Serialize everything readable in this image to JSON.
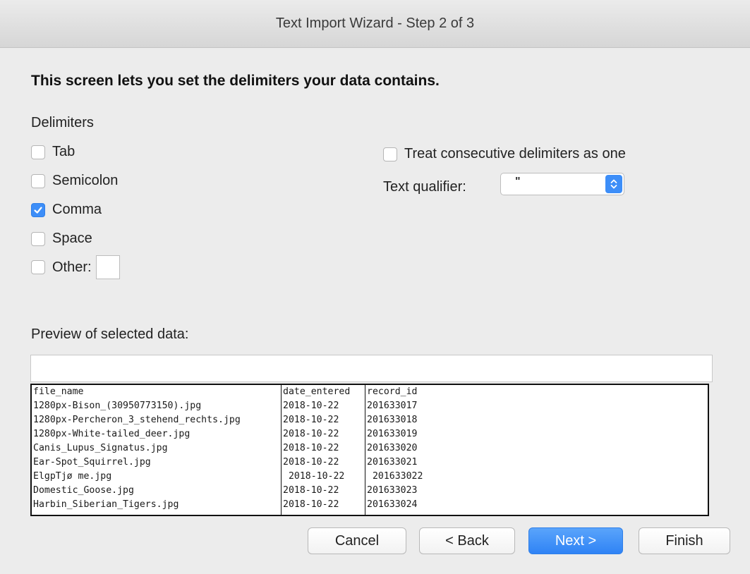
{
  "window": {
    "title": "Text Import Wizard - Step 2 of 3"
  },
  "heading": "This screen lets you set the delimiters your data contains.",
  "delimiters": {
    "label": "Delimiters",
    "tab": {
      "label": "Tab",
      "checked": false
    },
    "semicolon": {
      "label": "Semicolon",
      "checked": false
    },
    "comma": {
      "label": "Comma",
      "checked": true
    },
    "space": {
      "label": "Space",
      "checked": false
    },
    "other": {
      "label": "Other:",
      "checked": false,
      "value": ""
    }
  },
  "consecutive": {
    "label": "Treat consecutive delimiters as one",
    "checked": false
  },
  "qualifier": {
    "label": "Text qualifier:",
    "value": "\""
  },
  "preview": {
    "label": "Preview of selected data:",
    "rows": [
      [
        "file_name",
        "date_entered",
        "record_id"
      ],
      [
        "1280px-Bison_(30950773150).jpg",
        "2018-10-22",
        "201633017"
      ],
      [
        "1280px-Percheron_3_stehend_rechts.jpg",
        "2018-10-22",
        "201633018"
      ],
      [
        "1280px-White-tailed_deer.jpg",
        "2018-10-22",
        "201633019"
      ],
      [
        "Canis_Lupus_Signatus.jpg",
        "2018-10-22",
        "201633020"
      ],
      [
        "Ear-Spot_Squirrel.jpg",
        "2018-10-22",
        "201633021"
      ],
      [
        "ElgpTjø me.jpg",
        " 2018-10-22",
        " 201633022"
      ],
      [
        "Domestic_Goose.jpg",
        "2018-10-22",
        "201633023"
      ],
      [
        "Harbin_Siberian_Tigers.jpg",
        "2018-10-22",
        "201633024"
      ]
    ]
  },
  "buttons": {
    "cancel": "Cancel",
    "back": "< Back",
    "next": "Next >",
    "finish": "Finish"
  },
  "colors": {
    "accent": "#3d8ef8",
    "background": "#ececec"
  },
  "icons": {
    "checkmark": "checkmark-icon",
    "stepper": "up-down-chevron-icon"
  }
}
